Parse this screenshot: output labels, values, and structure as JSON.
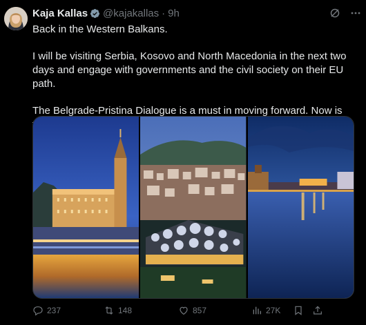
{
  "author": {
    "name": "Kaja Kallas",
    "handle": "@kajakallas",
    "separator": "·",
    "time": "9h",
    "verified_icon": "verified-badge-icon",
    "avatar_icon": "avatar"
  },
  "tweet": {
    "paragraphs": [
      "Back in the Western Balkans.",
      "I will be visiting Serbia, Kosovo and North Macedonia in the next two days and engage with governments and the civil society on their EU path.",
      "The Belgrade-Pristina Dialogue is a must in moving forward. Now is the time to re-engage."
    ]
  },
  "media": {
    "photos": [
      {
        "icon": "belgrade-night-photo"
      },
      {
        "icon": "pristina-cityscape-photo"
      },
      {
        "icon": "skopje-river-photo"
      }
    ]
  },
  "actions": {
    "replies": "237",
    "reposts": "148",
    "likes": "857",
    "views": "27K"
  },
  "colors": {
    "background": "#000000",
    "text": "#e7e9ea",
    "secondary": "#71767b",
    "verified": "#829aab"
  }
}
